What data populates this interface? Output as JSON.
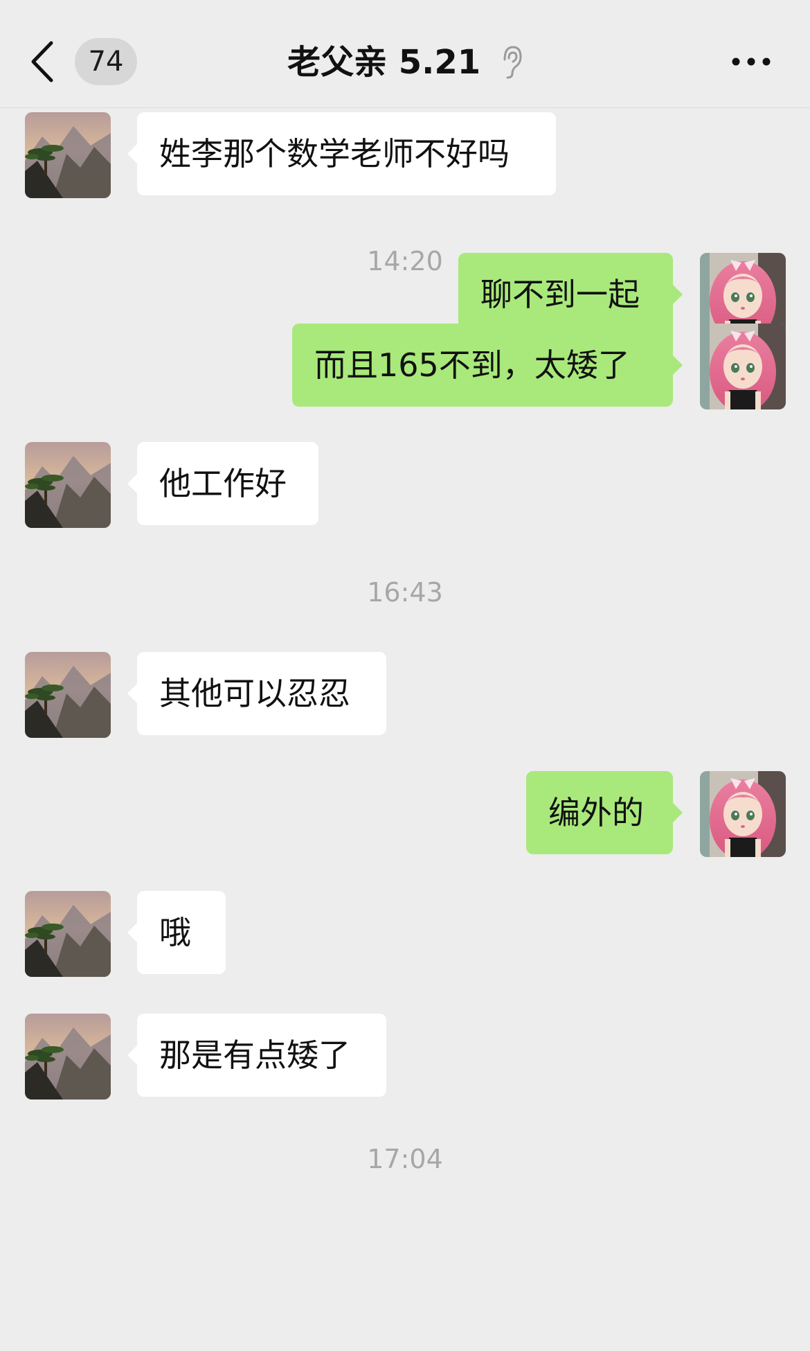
{
  "header": {
    "back_icon": "chevron-left-icon",
    "unread_count": "74",
    "title": "老父亲 5.21",
    "status_icon": "ear-icon",
    "more_icon": "more-dots-icon"
  },
  "avatars": {
    "father": "landscape-pine-avatar",
    "self": "anime-girl-avatar"
  },
  "colors": {
    "background": "#ededed",
    "incoming_bubble": "#ffffff",
    "outgoing_bubble": "#a9e87a",
    "timestamp": "#a7a7a7"
  },
  "messages": [
    {
      "type": "message",
      "direction": "incoming",
      "text": "姓李那个数学老师不好吗"
    },
    {
      "type": "time",
      "text": "14:20"
    },
    {
      "type": "message",
      "direction": "outgoing",
      "text": "聊不到一起"
    },
    {
      "type": "message",
      "direction": "outgoing",
      "text": "而且165不到，太矮了"
    },
    {
      "type": "time",
      "text": "16:43"
    },
    {
      "type": "message",
      "direction": "incoming",
      "text": "他工作好"
    },
    {
      "type": "message",
      "direction": "incoming",
      "text": "其他可以忍忍"
    },
    {
      "type": "message",
      "direction": "outgoing",
      "text": "编外的"
    },
    {
      "type": "message",
      "direction": "incoming",
      "text": "哦"
    },
    {
      "type": "time",
      "text": "17:04"
    },
    {
      "type": "message",
      "direction": "incoming",
      "text": "那是有点矮了"
    }
  ]
}
